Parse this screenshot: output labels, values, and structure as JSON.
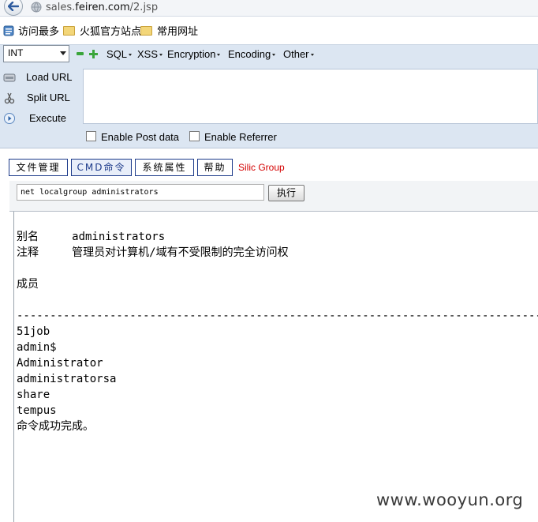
{
  "browser": {
    "url_host": "sales.",
    "url_domain": "feiren.com",
    "url_path": "/2.jsp"
  },
  "bookmarks": [
    {
      "label": "访问最多",
      "icon": "bookmark-list-icon"
    },
    {
      "label": "火狐官方站点",
      "icon": "folder-icon"
    },
    {
      "label": "常用网址",
      "icon": "folder-icon"
    }
  ],
  "hackbar": {
    "select_value": "INT",
    "menus": [
      "SQL",
      "XSS",
      "Encryption",
      "Encoding",
      "Other"
    ],
    "actions": [
      {
        "label": "Load URL",
        "icon": "load-url-icon"
      },
      {
        "label": "Split URL",
        "icon": "split-url-icon"
      },
      {
        "label": "Execute",
        "icon": "execute-icon"
      }
    ],
    "url_value": "",
    "enable_post": "Enable Post data",
    "enable_referrer": "Enable Referrer"
  },
  "page": {
    "tabs": [
      "文件管理",
      "CMD命令",
      "系统属性",
      "帮助"
    ],
    "active_tab": "CMD命令",
    "brand": "Silic Group",
    "command_value": "net localgroup administrators",
    "execute_label": "执行",
    "output": [
      "别名     administrators",
      "注释     管理员对计算机/域有不受限制的完全访问权",
      "",
      "成员",
      "",
      "-------------------------------------------------------------------------------",
      "51job",
      "admin$",
      "Administrator",
      "administratorsa",
      "share",
      "tempus",
      "命令成功完成。"
    ]
  },
  "watermark": "www.wooyun.org",
  "colors": {
    "hackbar_bg": "#dce6f2",
    "tab_border": "#1c3a8a",
    "brand": "#d40000"
  }
}
